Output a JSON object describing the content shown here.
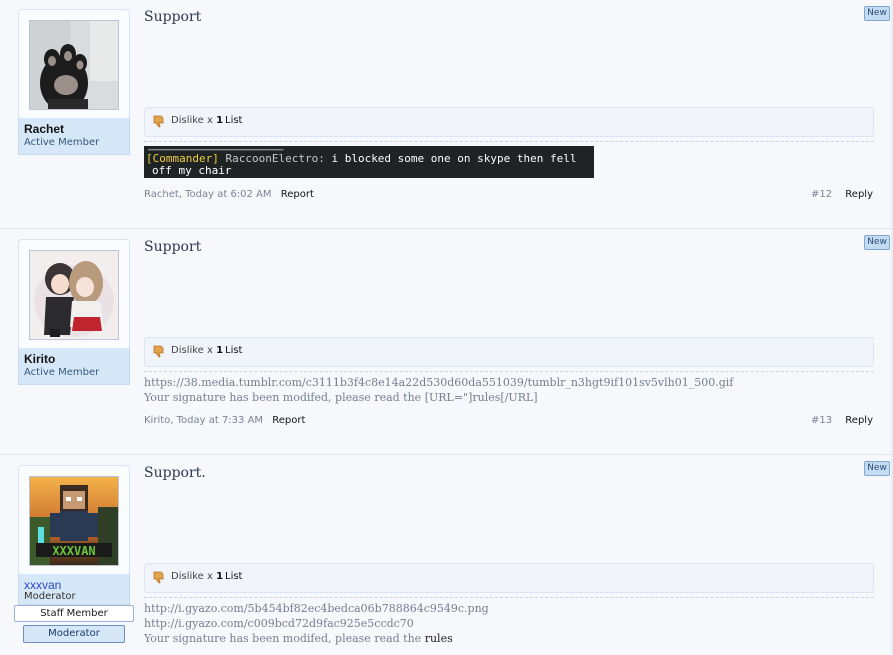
{
  "posts": [
    {
      "username": "Rachet",
      "user_title": "Active Member",
      "title": "Support",
      "dislike_label": "Dislike x",
      "dislike_count": "1",
      "list_label": "List",
      "author_date": "Rachet, Today at 6:02 AM",
      "report_label": "Report",
      "post_number": "#12",
      "reply_label": "Reply",
      "new_label": "New",
      "chat": {
        "tag": "[Commander]",
        "name": "RaccoonElectro:",
        "message": "i blocked some one on skype then fell",
        "message2": "off my chair"
      }
    },
    {
      "username": "Kirito",
      "user_title": "Active Member",
      "title": "Support",
      "dislike_label": "Dislike x",
      "dislike_count": "1",
      "list_label": "List",
      "signature_line1": "https://38.media.tumblr.com/c3111b3f4c8e14a22d530d60da551039/tumblr_n3hgt9if101sv5vlh01_500.gif",
      "signature_line2": "Your signature has been modifed, please read the [URL=\"]rules[/URL]",
      "author_date": "Kirito, Today at 7:33 AM",
      "report_label": "Report",
      "post_number": "#13",
      "reply_label": "Reply",
      "new_label": "New"
    },
    {
      "username": "xxxvan",
      "user_title": "Moderator",
      "staff_badge": "Staff Member",
      "mod_badge": "Moderator",
      "title": "Support.",
      "dislike_label": "Dislike x",
      "dislike_count": "1",
      "list_label": "List",
      "signature_line1": "http://i.gyazo.com/5b454bf82ec4bedca06b788864c9549c.png",
      "signature_line2": "http://i.gyazo.com/c009bcd72d9fac925e5ccdc70",
      "signature_line3_prefix": "Your signature has been modifed, please read the",
      "signature_line3_link": "rules",
      "new_label": "New"
    }
  ],
  "colors": {
    "background": "#f6f8fc",
    "user_panel": "#d6e7f7",
    "moderator_name": "#2b49c7",
    "new_flag": "#c4dcf2"
  }
}
